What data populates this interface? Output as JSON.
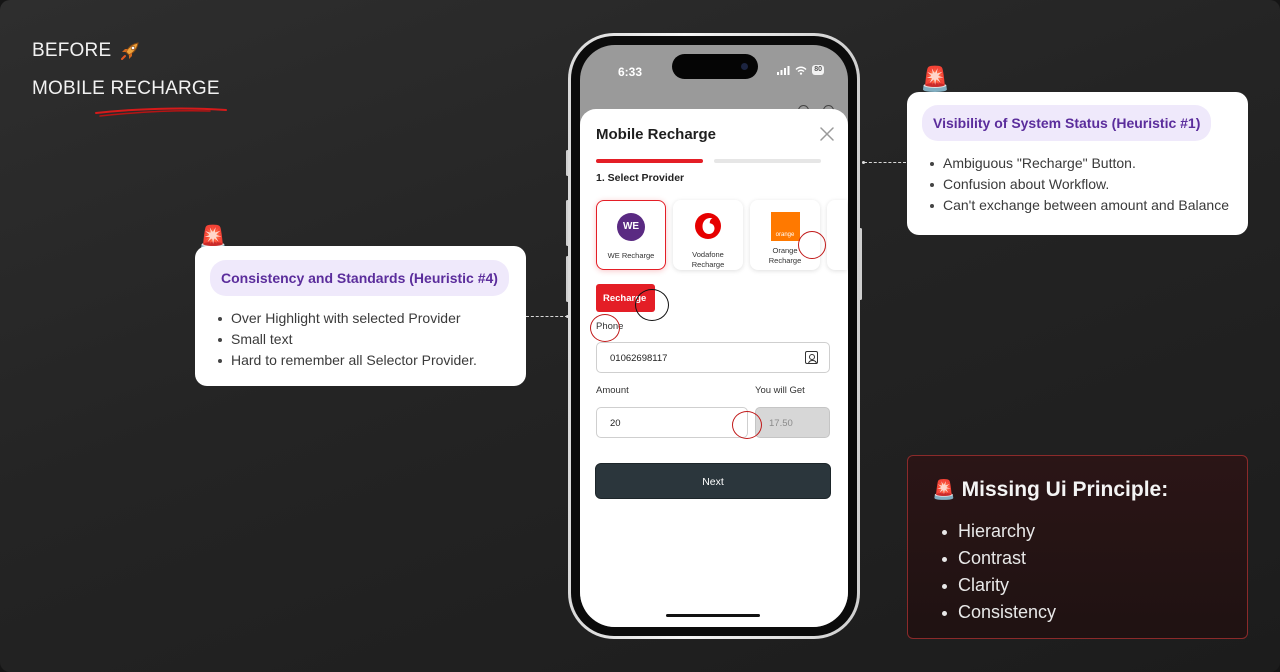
{
  "header": {
    "before_label": "BEFORE",
    "title": "MOBILE RECHARGE",
    "rocket_icon": "rocket-icon"
  },
  "callout_right": {
    "heading": "Visibility of System Status (Heuristic #1)",
    "items": [
      "Ambiguous \"Recharge\" Button.",
      "Confusion about Workflow.",
      "Can't exchange between amount and Balance"
    ],
    "icon": "siren-icon"
  },
  "callout_left": {
    "heading": "Consistency and Standards (Heuristic #4)",
    "items": [
      "Over Highlight with selected Provider",
      "Small text",
      "Hard to remember all Selector Provider."
    ],
    "icon": "siren-icon"
  },
  "missing": {
    "heading": "Missing Ui Principle:",
    "items": [
      "Hierarchy",
      "Contrast",
      "Clarity",
      "Consistency"
    ]
  },
  "phone": {
    "status": {
      "time": "6:33",
      "battery": "80"
    },
    "sheet": {
      "title": "Mobile Recharge",
      "step_label": "1. Select Provider",
      "providers": [
        {
          "logo_text": "WE",
          "label": "WE Recharge",
          "selected": true
        },
        {
          "label": "Vodafone Recharge",
          "label_line1": "Vodafone",
          "label_line2": "Recharge"
        },
        {
          "logo_text": "orange",
          "label": "Orange Recharge",
          "label_line1": "Orange",
          "label_line2": "Recharge"
        }
      ],
      "recharge_tag": "Recharge",
      "phone_label": "Phone",
      "phone_value": "01062698117",
      "amount_label": "Amount",
      "you_get_label": "You will Get",
      "amount_value": "20",
      "you_get_value": "17.50",
      "next_label": "Next"
    }
  },
  "colors": {
    "accent_red": "#e41e26",
    "heading_purple": "#5b2d9c",
    "pill_bg": "#efe9fb",
    "next_button": "#2b363c",
    "we_purple": "#5a2a82",
    "orange": "#ff7900"
  }
}
